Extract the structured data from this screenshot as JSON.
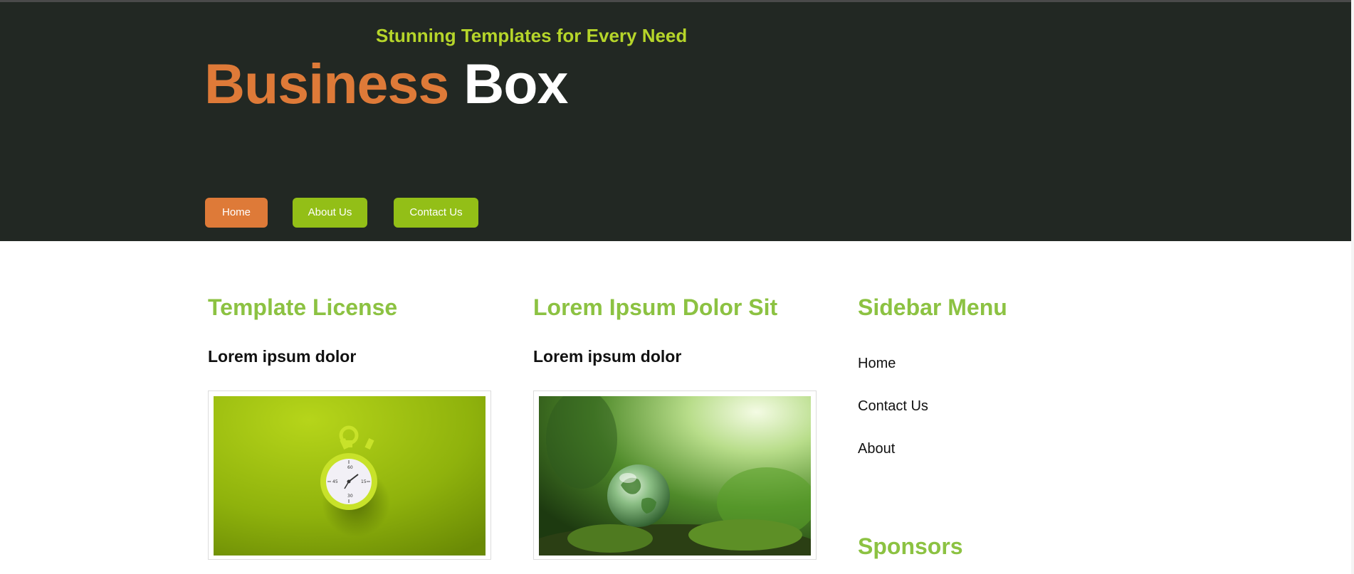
{
  "header": {
    "tagline": "Stunning Templates for Every Need",
    "logo_part1": "Business",
    "logo_part2": "Box",
    "nav": [
      {
        "label": "Home",
        "active": true
      },
      {
        "label": "About Us",
        "active": false
      },
      {
        "label": "Contact Us",
        "active": false
      }
    ]
  },
  "columns": [
    {
      "title": "Template License",
      "subtitle": "Lorem ipsum dolor",
      "image": "stopwatch-photo"
    },
    {
      "title": "Lorem Ipsum Dolor Sit",
      "subtitle": "Lorem ipsum dolor",
      "image": "glass-globe-photo"
    }
  ],
  "sidebar": {
    "title": "Sidebar Menu",
    "items": [
      "Home",
      "Contact Us",
      "About"
    ],
    "sponsors_title": "Sponsors"
  },
  "colors": {
    "header_bg": "#222823",
    "accent_orange": "#de7a38",
    "accent_green": "#93bf17",
    "heading_green": "#8cc242",
    "tagline_green": "#b6d52a"
  }
}
